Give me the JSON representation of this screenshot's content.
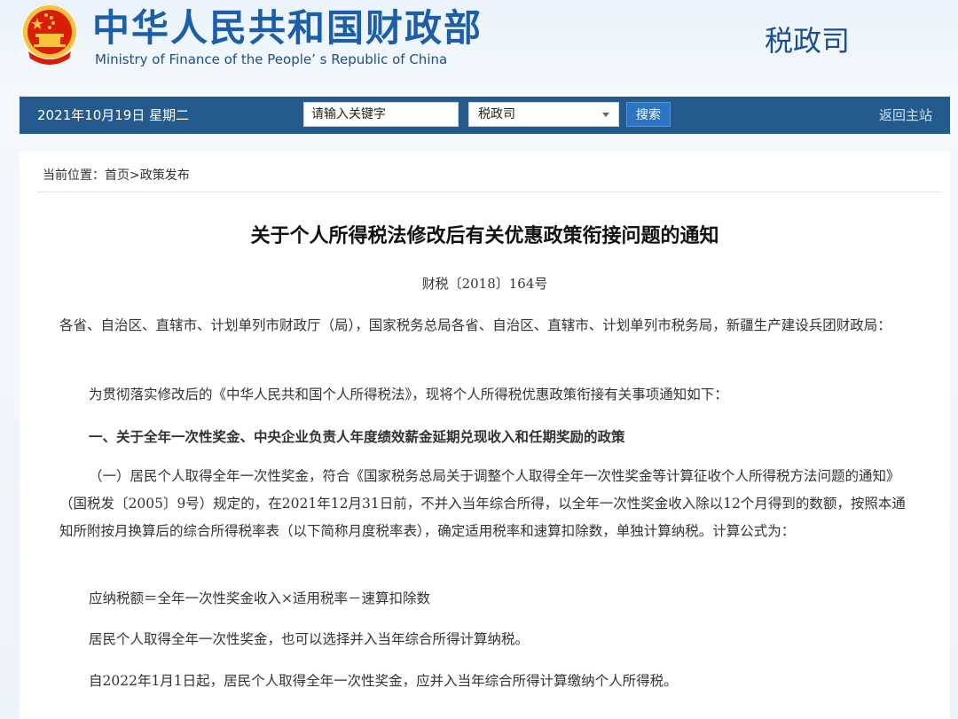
{
  "site": {
    "name_cn": "中华人民共和国财政部",
    "name_en": "Ministry of Finance of the People’ s Republic of China",
    "department": "税政司"
  },
  "navbar": {
    "date": "2021年10月19日  星期二",
    "search_placeholder": "请输入关键字",
    "scope_selected": "税政司",
    "search_button": "搜索",
    "back_home": "返回主站"
  },
  "breadcrumb": "当前位置：首页>政策发布",
  "article": {
    "title": "关于个人所得税法修改后有关优惠政策衔接问题的通知",
    "doc_number": "财税〔2018〕164号",
    "paragraphs": [
      "各省、自治区、直辖市、计划单列市财政厅（局），国家税务总局各省、自治区、直辖市、计划单列市税务局，新疆生产建设兵团财政局：",
      "为贯彻落实修改后的《中华人民共和国个人所得税法》，现将个人所得税优惠政策衔接有关事项通知如下：",
      "一、关于全年一次性奖金、中央企业负责人年度绩效薪金延期兑现收入和任期奖励的政策",
      "（一）居民个人取得全年一次性奖金，符合《国家税务总局关于调整个人取得全年一次性奖金等计算征收个人所得税方法问题的通知》（国税发〔2005〕9号）规定的，在2021年12月31日前，不并入当年综合所得，以全年一次性奖金收入除以12个月得到的数额，按照本通知所附按月换算后的综合所得税率表（以下简称月度税率表），确定适用税率和速算扣除数，单独计算纳税。计算公式为：",
      "应纳税额＝全年一次性奖金收入×适用税率－速算扣除数",
      "居民个人取得全年一次性奖金，也可以选择并入当年综合所得计算纳税。",
      "自2022年1月1日起，居民个人取得全年一次性奖金，应并入当年综合所得计算缴纳个人所得税。"
    ]
  },
  "colors": {
    "brand_blue": "#1c5ea8",
    "navbar_bg": "#245a8d",
    "emblem_red": "#d81e06",
    "emblem_gold": "#f6c33b"
  },
  "icons": {
    "emblem": "national-emblem-icon",
    "dropdown": "chevron-down-icon"
  }
}
